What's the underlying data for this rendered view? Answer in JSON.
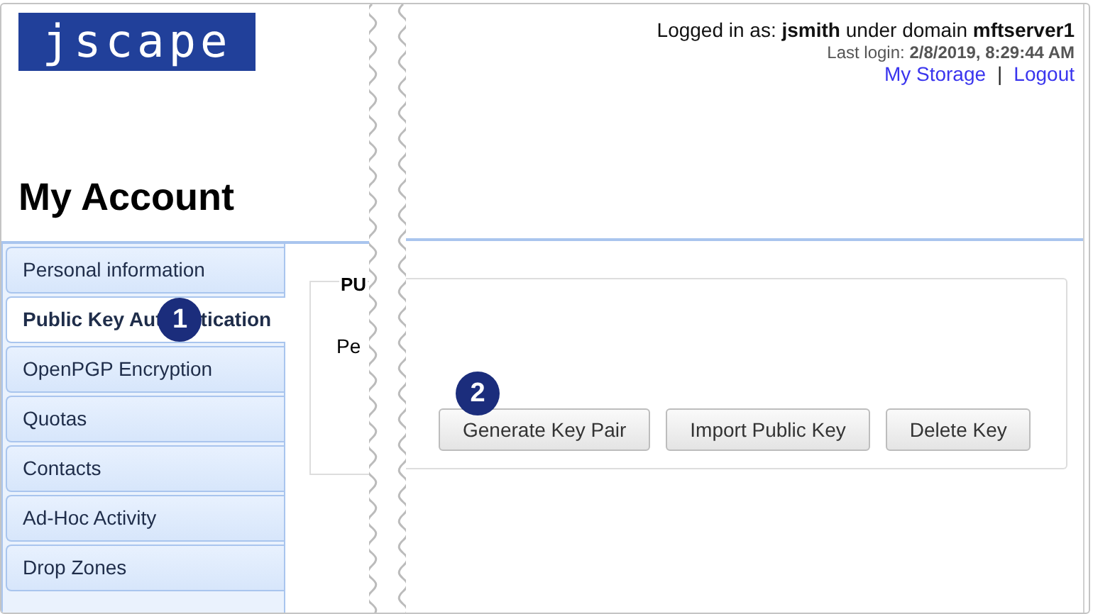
{
  "header": {
    "logo": "jscape",
    "user_line": "Logged in as: **jsmith** under domain **mftserver1**",
    "last_login": "Last login: **2/8/2019, 8:29:44 AM**",
    "links": [
      "My Storage",
      "Logout"
    ],
    "separator": "|"
  },
  "page_title": "My Account",
  "sidebar": {
    "items": [
      {
        "label": "Personal information",
        "selected": false
      },
      {
        "label": "Public Key Aut",
        "label_end": "tication",
        "selected": true
      },
      {
        "label": "OpenPGP Encryption",
        "selected": false
      },
      {
        "label": "Quotas",
        "selected": false
      },
      {
        "label": "Contacts",
        "selected": false
      },
      {
        "label": "Ad-Hoc Activity",
        "selected": false
      },
      {
        "label": "Drop Zones",
        "selected": false
      }
    ]
  },
  "section": {
    "legend": "PU",
    "label": "Pe",
    "buttons": [
      "Generate Key Pair",
      "Import Public Key",
      "Delete Key"
    ]
  },
  "callouts": [
    "1",
    "2"
  ]
}
